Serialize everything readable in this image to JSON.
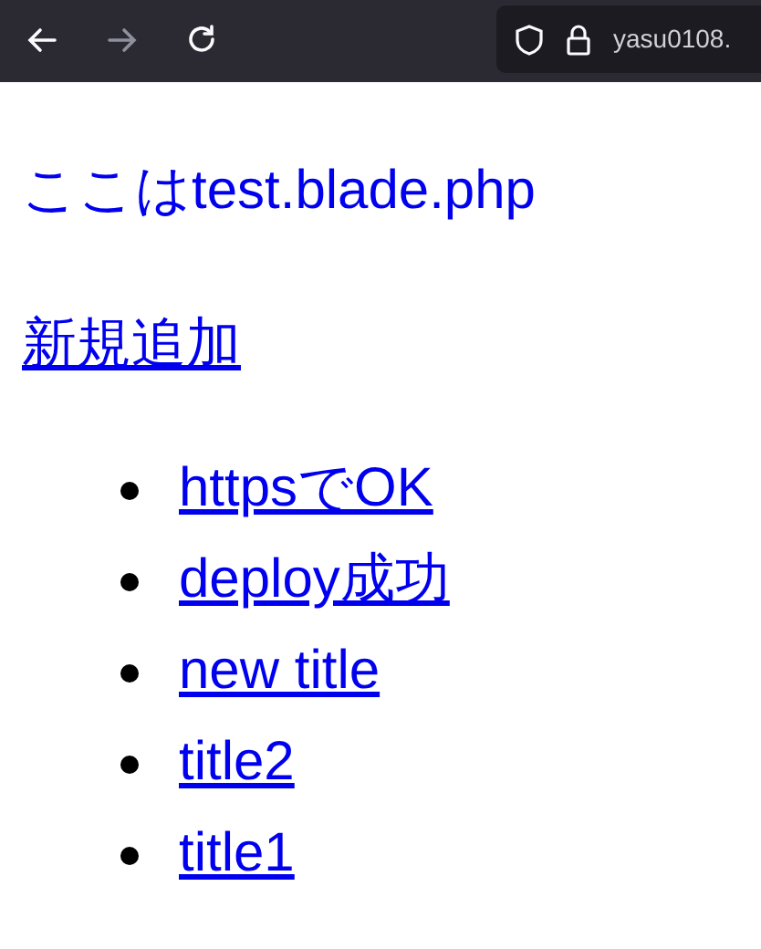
{
  "toolbar": {
    "forward_disabled": true,
    "url": "yasu0108."
  },
  "heading": "ここはtest.blade.php",
  "add_link": "新規追加",
  "posts": [
    "httpsでOK",
    "deploy成功",
    "new title",
    "title2",
    "title1"
  ]
}
